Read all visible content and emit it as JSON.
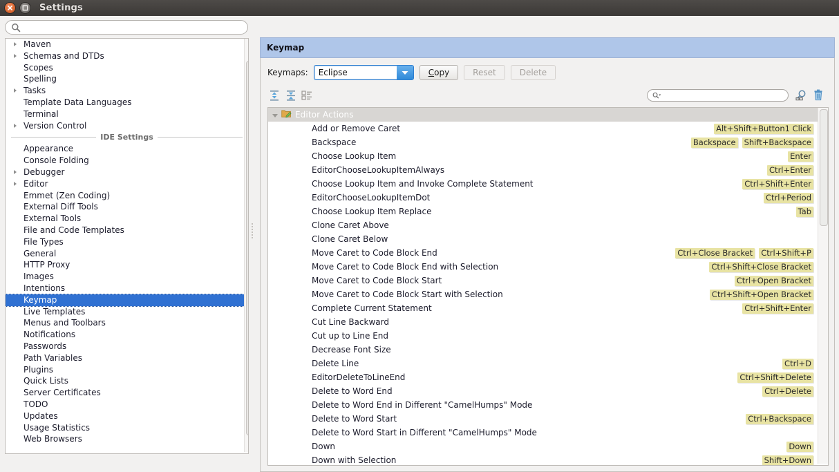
{
  "window": {
    "title": "Settings",
    "close_icon": "close-icon",
    "maximize_icon": "maximize-icon"
  },
  "sidebar": {
    "search": {
      "value": "",
      "placeholder": "",
      "icon": "search-icon"
    },
    "items": [
      {
        "label": "Maven",
        "expandable": true,
        "selected": false
      },
      {
        "label": "Schemas and DTDs",
        "expandable": true,
        "selected": false
      },
      {
        "label": "Scopes",
        "expandable": false,
        "selected": false
      },
      {
        "label": "Spelling",
        "expandable": false,
        "selected": false
      },
      {
        "label": "Tasks",
        "expandable": true,
        "selected": false
      },
      {
        "label": "Template Data Languages",
        "expandable": false,
        "selected": false
      },
      {
        "label": "Terminal",
        "expandable": false,
        "selected": false
      },
      {
        "label": "Version Control",
        "expandable": true,
        "selected": false
      }
    ],
    "separator_label": "IDE Settings",
    "ide_items": [
      {
        "label": "Appearance",
        "expandable": false,
        "selected": false
      },
      {
        "label": "Console Folding",
        "expandable": false,
        "selected": false
      },
      {
        "label": "Debugger",
        "expandable": true,
        "selected": false
      },
      {
        "label": "Editor",
        "expandable": true,
        "selected": false
      },
      {
        "label": "Emmet (Zen Coding)",
        "expandable": false,
        "selected": false
      },
      {
        "label": "External Diff Tools",
        "expandable": false,
        "selected": false
      },
      {
        "label": "External Tools",
        "expandable": false,
        "selected": false
      },
      {
        "label": "File and Code Templates",
        "expandable": false,
        "selected": false
      },
      {
        "label": "File Types",
        "expandable": false,
        "selected": false
      },
      {
        "label": "General",
        "expandable": false,
        "selected": false
      },
      {
        "label": "HTTP Proxy",
        "expandable": false,
        "selected": false
      },
      {
        "label": "Images",
        "expandable": false,
        "selected": false
      },
      {
        "label": "Intentions",
        "expandable": false,
        "selected": false
      },
      {
        "label": "Keymap",
        "expandable": false,
        "selected": true
      },
      {
        "label": "Live Templates",
        "expandable": false,
        "selected": false
      },
      {
        "label": "Menus and Toolbars",
        "expandable": false,
        "selected": false
      },
      {
        "label": "Notifications",
        "expandable": false,
        "selected": false
      },
      {
        "label": "Passwords",
        "expandable": false,
        "selected": false
      },
      {
        "label": "Path Variables",
        "expandable": false,
        "selected": false
      },
      {
        "label": "Plugins",
        "expandable": false,
        "selected": false
      },
      {
        "label": "Quick Lists",
        "expandable": false,
        "selected": false
      },
      {
        "label": "Server Certificates",
        "expandable": false,
        "selected": false
      },
      {
        "label": "TODO",
        "expandable": false,
        "selected": false
      },
      {
        "label": "Updates",
        "expandable": false,
        "selected": false
      },
      {
        "label": "Usage Statistics",
        "expandable": false,
        "selected": false
      },
      {
        "label": "Web Browsers",
        "expandable": false,
        "selected": false
      }
    ]
  },
  "panel": {
    "title": "Keymap",
    "keymaps_label": "Keymaps:",
    "keymaps_selected": "Eclipse",
    "copy_button": "Copy",
    "copy_button_mnemonic": "C",
    "copy_button_rest": "opy",
    "reset_button": "Reset",
    "delete_button": "Delete",
    "toolbar_icons": [
      "expand-all-icon",
      "collapse-all-icon",
      "edit-shortcut-icon"
    ],
    "filter": {
      "value": "",
      "placeholder": "",
      "icon": "search-dropdown-icon"
    },
    "find_shortcut_icon": "find-by-shortcut-icon",
    "clear_filter_icon": "trash-icon",
    "accent_selection": "#3071d2",
    "accent_header": "#afc6e9",
    "shortcut_badge_color": "#e8e3a3"
  },
  "keymap_list": {
    "group": {
      "label": "Editor Actions",
      "icon": "folder-edit-icon",
      "expanded": true
    },
    "rows": [
      {
        "action": "Add or Remove Caret",
        "shortcuts": [
          "Alt+Shift+Button1 Click"
        ]
      },
      {
        "action": "Backspace",
        "shortcuts": [
          "Backspace",
          "Shift+Backspace"
        ]
      },
      {
        "action": "Choose Lookup Item",
        "shortcuts": [
          "Enter"
        ]
      },
      {
        "action": "EditorChooseLookupItemAlways",
        "shortcuts": [
          "Ctrl+Enter"
        ]
      },
      {
        "action": "Choose Lookup Item and Invoke Complete Statement",
        "shortcuts": [
          "Ctrl+Shift+Enter"
        ]
      },
      {
        "action": "EditorChooseLookupItemDot",
        "shortcuts": [
          "Ctrl+Period"
        ]
      },
      {
        "action": "Choose Lookup Item Replace",
        "shortcuts": [
          "Tab"
        ]
      },
      {
        "action": "Clone Caret Above",
        "shortcuts": []
      },
      {
        "action": "Clone Caret Below",
        "shortcuts": []
      },
      {
        "action": "Move Caret to Code Block End",
        "shortcuts": [
          "Ctrl+Close Bracket",
          "Ctrl+Shift+P"
        ]
      },
      {
        "action": "Move Caret to Code Block End with Selection",
        "shortcuts": [
          "Ctrl+Shift+Close Bracket"
        ]
      },
      {
        "action": "Move Caret to Code Block Start",
        "shortcuts": [
          "Ctrl+Open Bracket"
        ]
      },
      {
        "action": "Move Caret to Code Block Start with Selection",
        "shortcuts": [
          "Ctrl+Shift+Open Bracket"
        ]
      },
      {
        "action": "Complete Current Statement",
        "shortcuts": [
          "Ctrl+Shift+Enter"
        ]
      },
      {
        "action": "Cut Line Backward",
        "shortcuts": []
      },
      {
        "action": "Cut up to Line End",
        "shortcuts": []
      },
      {
        "action": "Decrease Font Size",
        "shortcuts": []
      },
      {
        "action": "Delete Line",
        "shortcuts": [
          "Ctrl+D"
        ]
      },
      {
        "action": "EditorDeleteToLineEnd",
        "shortcuts": [
          "Ctrl+Shift+Delete"
        ]
      },
      {
        "action": "Delete to Word End",
        "shortcuts": [
          "Ctrl+Delete"
        ]
      },
      {
        "action": "Delete to Word End in Different \"CamelHumps\" Mode",
        "shortcuts": []
      },
      {
        "action": "Delete to Word Start",
        "shortcuts": [
          "Ctrl+Backspace"
        ]
      },
      {
        "action": "Delete to Word Start in Different \"CamelHumps\" Mode",
        "shortcuts": []
      },
      {
        "action": "Down",
        "shortcuts": [
          "Down"
        ]
      },
      {
        "action": "Down with Selection",
        "shortcuts": [
          "Shift+Down"
        ]
      }
    ]
  }
}
